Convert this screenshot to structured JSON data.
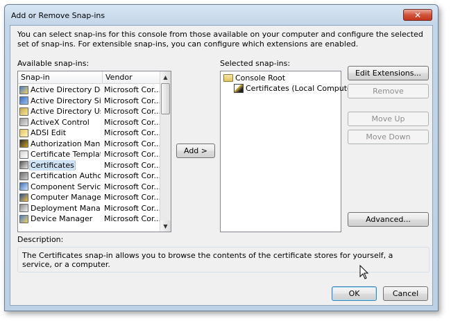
{
  "window": {
    "title": "Add or Remove Snap-ins",
    "close_glyph": "✕"
  },
  "intro_text": "You can select snap-ins for this console from those available on your computer and configure the selected set of snap-ins. For extensible snap-ins, you can configure which extensions are enabled.",
  "available": {
    "label": "Available snap-ins:",
    "columns": {
      "snapin": "Snap-in",
      "vendor": "Vendor"
    },
    "items": [
      {
        "name": "Active Directory Do...",
        "vendor": "Microsoft Cor...",
        "icon": "active-directory-domains-icon"
      },
      {
        "name": "Active Directory Site...",
        "vendor": "Microsoft Cor...",
        "icon": "active-directory-sites-icon"
      },
      {
        "name": "Active Directory Use...",
        "vendor": "Microsoft Cor...",
        "icon": "active-directory-users-icon"
      },
      {
        "name": "ActiveX Control",
        "vendor": "Microsoft Cor...",
        "icon": "activex-control-icon"
      },
      {
        "name": "ADSI Edit",
        "vendor": "Microsoft Cor...",
        "icon": "adsi-edit-icon"
      },
      {
        "name": "Authorization Manager",
        "vendor": "Microsoft Cor...",
        "icon": "authorization-manager-icon"
      },
      {
        "name": "Certificate Templates",
        "vendor": "Microsoft Cor...",
        "icon": "certificate-templates-icon"
      },
      {
        "name": "Certificates",
        "vendor": "Microsoft Cor...",
        "icon": "certificates-icon",
        "selected": true
      },
      {
        "name": "Certification Authority",
        "vendor": "Microsoft Cor...",
        "icon": "certification-authority-icon"
      },
      {
        "name": "Component Services",
        "vendor": "Microsoft Cor...",
        "icon": "component-services-icon"
      },
      {
        "name": "Computer Managem...",
        "vendor": "Microsoft Cor...",
        "icon": "computer-management-icon"
      },
      {
        "name": "Deployment Manager",
        "vendor": "Microsoft Cor...",
        "icon": "deployment-manager-icon"
      },
      {
        "name": "Device Manager",
        "vendor": "Microsoft Cor...",
        "icon": "device-manager-icon"
      }
    ],
    "scroll_up_glyph": "▲",
    "scroll_down_glyph": "▼"
  },
  "add_button": "Add >",
  "selected": {
    "label": "Selected snap-ins:",
    "root": "Console Root",
    "child": "Certificates (Local Computer)"
  },
  "buttons": {
    "edit_extensions": "Edit Extensions...",
    "remove": "Remove",
    "move_up": "Move Up",
    "move_down": "Move Down",
    "advanced": "Advanced...",
    "ok": "OK",
    "cancel": "Cancel"
  },
  "description": {
    "label": "Description:",
    "text": "The Certificates snap-in allows you to browse the contents of the certificate stores for yourself, a service, or a computer."
  }
}
